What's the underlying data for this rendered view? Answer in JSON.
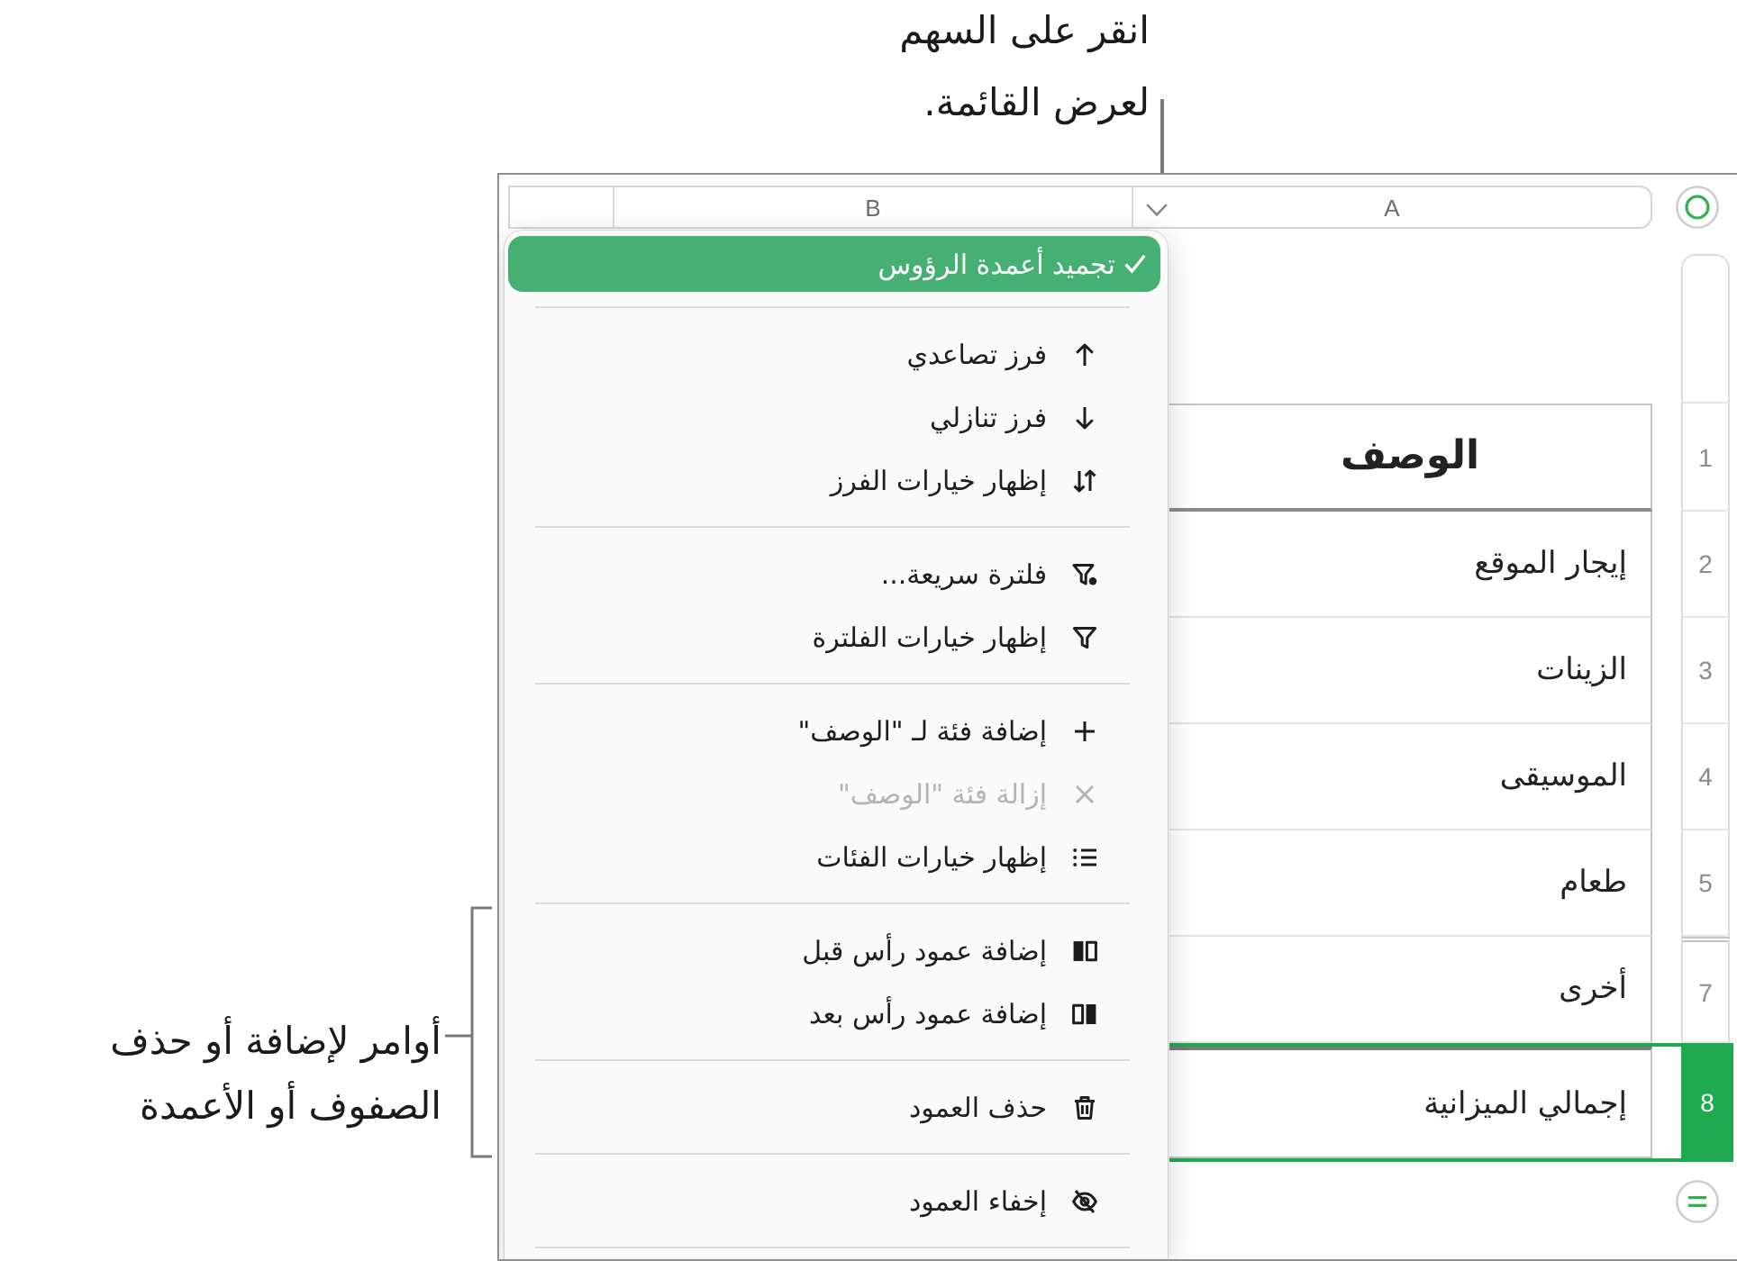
{
  "callouts": {
    "menu_hint": "انقر على السهم\nلعرض القائمة.",
    "commands_hint": "أوامر لإضافة أو حذف\nالصفوف أو الأعمدة"
  },
  "column_headers": [
    {
      "label": "A",
      "menu_arrow": true
    },
    {
      "label": "B",
      "menu_arrow": false
    }
  ],
  "menu": {
    "top_item": {
      "label": "تجميد أعمدة الرؤوس",
      "checked": true,
      "highlighted": true
    },
    "sections": [
      {
        "items": [
          {
            "kind": "ascending",
            "label": "فرز تصاعدي",
            "disabled": false
          },
          {
            "kind": "descending",
            "label": "فرز تنازلي",
            "disabled": false
          },
          {
            "kind": "sort",
            "label": "إظهار خيارات الفرز",
            "disabled": false
          }
        ]
      },
      {
        "items": [
          {
            "kind": "quickfilter",
            "label": "فلترة سريعة...",
            "disabled": false
          },
          {
            "kind": "filter",
            "label": "إظهار خيارات الفلترة",
            "disabled": false
          }
        ]
      },
      {
        "items": [
          {
            "kind": "add",
            "label": "إضافة فئة لـ \"الوصف\"",
            "disabled": false
          },
          {
            "kind": "remove",
            "label": "إزالة فئة \"الوصف\"",
            "disabled": true
          },
          {
            "kind": "categories",
            "label": "إظهار خيارات الفئات",
            "disabled": false
          }
        ]
      },
      {
        "items": [
          {
            "kind": "before",
            "label": "إضافة عمود رأس قبل",
            "disabled": false
          },
          {
            "kind": "after",
            "label": "إضافة عمود رأس بعد",
            "disabled": false
          }
        ]
      },
      {
        "items": [
          {
            "kind": "delete",
            "label": "حذف العمود",
            "disabled": false
          }
        ]
      },
      {
        "items": [
          {
            "kind": "hide",
            "label": "إخفاء العمود",
            "disabled": false
          }
        ]
      }
    ]
  },
  "table": {
    "rows": [
      {
        "kind": "header",
        "number": "1",
        "label": "الوصف",
        "selected": false,
        "hidden_rows_before": false
      },
      {
        "kind": "body",
        "number": "2",
        "label": "إيجار الموقع",
        "selected": false,
        "hidden_rows_before": false
      },
      {
        "kind": "body",
        "number": "3",
        "label": "الزينات",
        "selected": false,
        "hidden_rows_before": false
      },
      {
        "kind": "body",
        "number": "4",
        "label": "الموسيقى",
        "selected": false,
        "hidden_rows_before": false
      },
      {
        "kind": "body",
        "number": "5",
        "label": "طعام",
        "selected": false,
        "hidden_rows_before": false
      },
      {
        "kind": "body",
        "number": "7",
        "label": "أخرى",
        "selected": false,
        "hidden_rows_before": true
      },
      {
        "kind": "footer",
        "number": "8",
        "label": "إجمالي الميزانية",
        "selected": true,
        "hidden_rows_before": false
      }
    ]
  }
}
